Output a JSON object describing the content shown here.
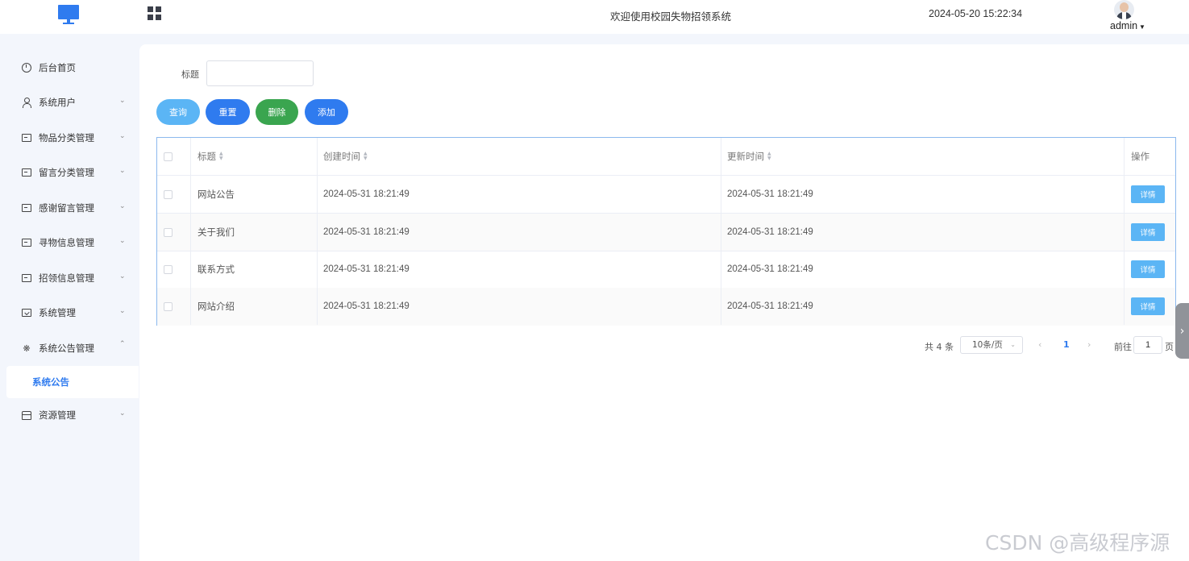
{
  "header": {
    "welcome": "欢迎使用校园失物招领系统",
    "datetime": "2024-05-20 15:22:34",
    "user": "admin",
    "logo_icon": "monitor-icon",
    "menu_icon": "grid-icon"
  },
  "sidebar": {
    "items": [
      {
        "label": "后台首页",
        "icon": "clock-icon"
      },
      {
        "label": "系统用户",
        "icon": "user-icon"
      },
      {
        "label": "物品分类管理",
        "icon": "card-icon"
      },
      {
        "label": "留言分类管理",
        "icon": "card-icon"
      },
      {
        "label": "感谢留言管理",
        "icon": "card-icon"
      },
      {
        "label": "寻物信息管理",
        "icon": "card-icon"
      },
      {
        "label": "招领信息管理",
        "icon": "card-icon"
      },
      {
        "label": "系统管理",
        "icon": "check-box-icon"
      },
      {
        "label": "系统公告管理",
        "icon": "sparkle-icon"
      },
      {
        "label": "资源管理",
        "icon": "shop-icon"
      }
    ],
    "active_sub": "系统公告"
  },
  "search": {
    "label": "标题",
    "value": "",
    "placeholder": ""
  },
  "buttons": {
    "query": "查询",
    "reset": "重置",
    "delete": "删除",
    "add": "添加"
  },
  "table": {
    "headers": {
      "title": "标题",
      "created": "创建时间",
      "updated": "更新时间",
      "actions": "操作"
    },
    "rows": [
      {
        "title": "网站公告",
        "created": "2024-05-31 18:21:49",
        "updated": "2024-05-31 18:21:49",
        "action": "详情"
      },
      {
        "title": "关于我们",
        "created": "2024-05-31 18:21:49",
        "updated": "2024-05-31 18:21:49",
        "action": "详情"
      },
      {
        "title": "联系方式",
        "created": "2024-05-31 18:21:49",
        "updated": "2024-05-31 18:21:49",
        "action": "详情"
      },
      {
        "title": "网站介绍",
        "created": "2024-05-31 18:21:49",
        "updated": "2024-05-31 18:21:49",
        "action": "详情"
      }
    ]
  },
  "pagination": {
    "total": "共 4 条",
    "page_size": "10条/页",
    "current_page": "1",
    "goto_label": "前往",
    "goto_value": "1",
    "page_suffix": "页"
  },
  "watermark": "CSDN @高级程序源",
  "colors": {
    "primary": "#2f7bef",
    "query": "#5bb5f5",
    "delete": "#3aa54f",
    "sidebar_bg": "#f3f6fc"
  }
}
